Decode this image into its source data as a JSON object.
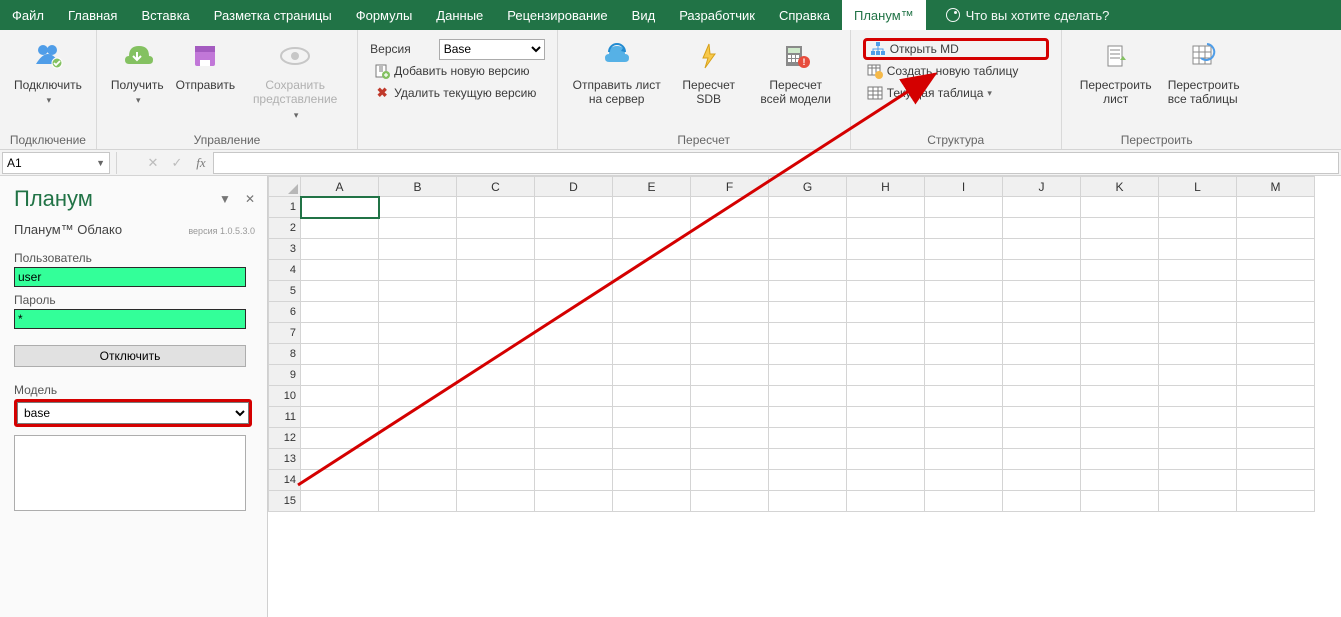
{
  "menu": {
    "items": [
      "Файл",
      "Главная",
      "Вставка",
      "Разметка страницы",
      "Формулы",
      "Данные",
      "Рецензирование",
      "Вид",
      "Разработчик",
      "Справка",
      "Планум™"
    ],
    "active_index": 10,
    "tell_me": "Что вы хотите сделать?"
  },
  "ribbon": {
    "groups": {
      "connection": {
        "label": "Подключение",
        "connect": "Подключить",
        "fetch": "Получить",
        "send": "Отправить",
        "save_view": "Сохранить представление"
      },
      "management": {
        "label": "Управление",
        "version_label": "Версия",
        "version_value": "Base",
        "add_version": "Добавить новую версию",
        "delete_version": "Удалить текущую версию"
      },
      "recalc": {
        "label": "Пересчет",
        "send_sheet": "Отправить лист на сервер",
        "recalc_sdb": "Пересчет SDB",
        "recalc_model": "Пересчет всей модели"
      },
      "structure": {
        "label": "Структура",
        "open_md": "Открыть MD",
        "new_table": "Создать новую таблицу",
        "current_table": "Текущая таблица"
      },
      "rebuild": {
        "label": "Перестроить",
        "rebuild_sheet": "Перестроить лист",
        "rebuild_all": "Перестроить все таблицы"
      }
    }
  },
  "formula_bar": {
    "cell_ref": "A1",
    "formula": ""
  },
  "taskpane": {
    "title": "Планум",
    "subtitle": "Планум™ Облако",
    "version": "версия 1.0.5.3.0",
    "user_label": "Пользователь",
    "user_value": "user",
    "pass_label": "Пароль",
    "pass_value": "*",
    "disconnect": "Отключить",
    "model_label": "Модель",
    "model_value": "base"
  },
  "grid": {
    "columns": [
      "A",
      "B",
      "C",
      "D",
      "E",
      "F",
      "G",
      "H",
      "I",
      "J",
      "K",
      "L",
      "M"
    ],
    "rows": [
      1,
      2,
      3,
      4,
      5,
      6,
      7,
      8,
      9,
      10,
      11,
      12,
      13,
      14,
      15
    ],
    "selected": "A1"
  }
}
